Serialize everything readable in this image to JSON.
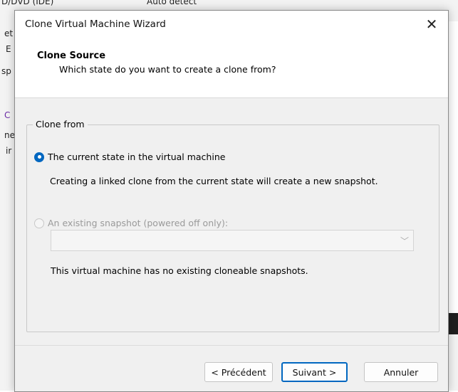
{
  "background": {
    "fragments": [
      "D/DVD (IDE)",
      "Auto detect",
      "et",
      "E",
      "sp",
      "C",
      "ne",
      "ir"
    ]
  },
  "dialog": {
    "title": "Clone Virtual Machine Wizard",
    "close_glyph": "✕"
  },
  "header": {
    "title": "Clone Source",
    "subtitle": "Which state do you want to create a clone from?"
  },
  "group": {
    "legend": "Clone from",
    "option_current": {
      "label": "The current state in the virtual machine",
      "selected": true,
      "description": "Creating a linked clone from the current state will create a new snapshot."
    },
    "option_snapshot": {
      "label": "An existing snapshot (powered off only):",
      "selected": false,
      "enabled": false,
      "dropdown_value": "",
      "note": "This virtual machine has no existing cloneable snapshots."
    }
  },
  "buttons": {
    "back": "< Précédent",
    "next": "Suivant >",
    "cancel": "Annuler"
  },
  "colors": {
    "accent": "#0067c0",
    "dialog_bg": "#f0f0f0",
    "disabled_text": "#9a9a9a"
  }
}
